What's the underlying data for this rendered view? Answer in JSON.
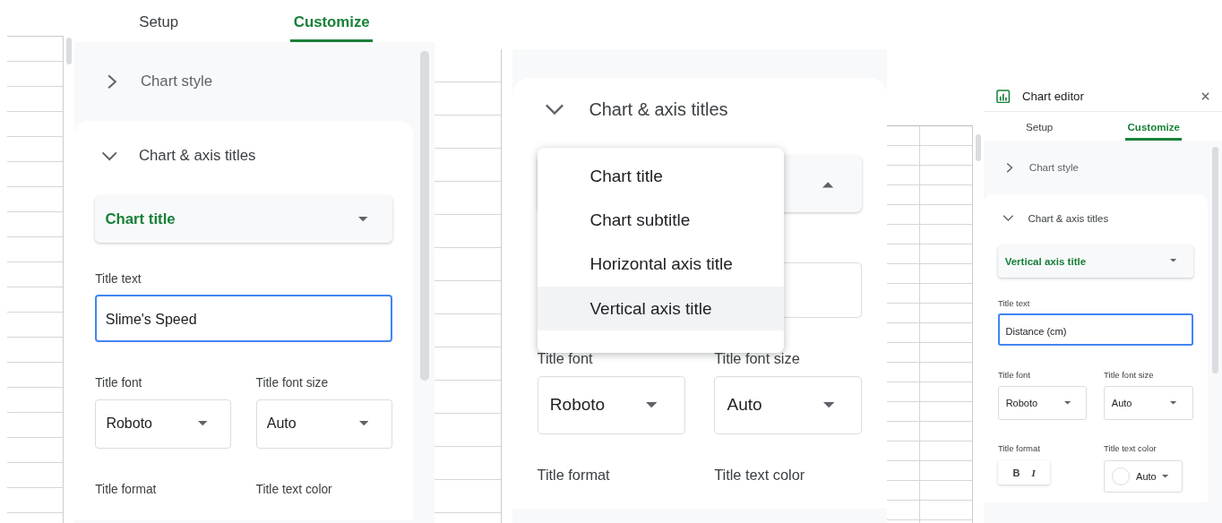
{
  "panels": [
    {
      "tabs": [
        {
          "label": "Setup",
          "selected": false
        },
        {
          "label": "Customize",
          "selected": true
        }
      ],
      "sections": [
        {
          "label": "Chart style",
          "expanded": false
        },
        {
          "label": "Chart & axis titles",
          "expanded": true,
          "type_dropdown": {
            "value": "Chart title",
            "open": false
          },
          "title_text": {
            "label": "Title text",
            "value": "Slime's Speed",
            "focused": true
          },
          "font": {
            "label": "Title font",
            "value": "Roboto"
          },
          "font_size": {
            "label": "Title font size",
            "value": "Auto"
          },
          "format": {
            "label": "Title format"
          },
          "text_color": {
            "label": "Title text color"
          }
        }
      ]
    },
    {
      "sections": [
        {
          "label": "Chart & axis titles",
          "expanded": true,
          "type_dropdown": {
            "open": true
          },
          "menu": [
            {
              "label": "Chart title",
              "selected": false
            },
            {
              "label": "Chart subtitle",
              "selected": false
            },
            {
              "label": "Horizontal axis title",
              "selected": false
            },
            {
              "label": "Vertical axis title",
              "selected": true
            }
          ],
          "title_text": {
            "focused": false
          },
          "font": {
            "label": "Title font",
            "value": "Roboto"
          },
          "font_size": {
            "label": "Title font size",
            "value": "Auto"
          },
          "format": {
            "label": "Title format"
          },
          "text_color": {
            "label": "Title text color"
          }
        }
      ]
    },
    {
      "editor_title": "Chart editor",
      "tabs": [
        {
          "label": "Setup",
          "selected": false
        },
        {
          "label": "Customize",
          "selected": true
        }
      ],
      "sections": [
        {
          "label": "Chart style",
          "expanded": false
        },
        {
          "label": "Chart & axis titles",
          "expanded": true,
          "type_dropdown": {
            "value": "Vertical axis title",
            "open": false
          },
          "title_text": {
            "label": "Title text",
            "value": "Distance (cm)",
            "focused": true
          },
          "font": {
            "label": "Title font",
            "value": "Roboto"
          },
          "font_size": {
            "label": "Title font size",
            "value": "Auto"
          },
          "format": {
            "label": "Title format",
            "buttons": [
              {
                "label": "B",
                "kind": "bold"
              },
              {
                "label": "I",
                "kind": "italic"
              }
            ]
          },
          "text_color": {
            "label": "Title text color",
            "value": "Auto"
          }
        }
      ]
    }
  ]
}
